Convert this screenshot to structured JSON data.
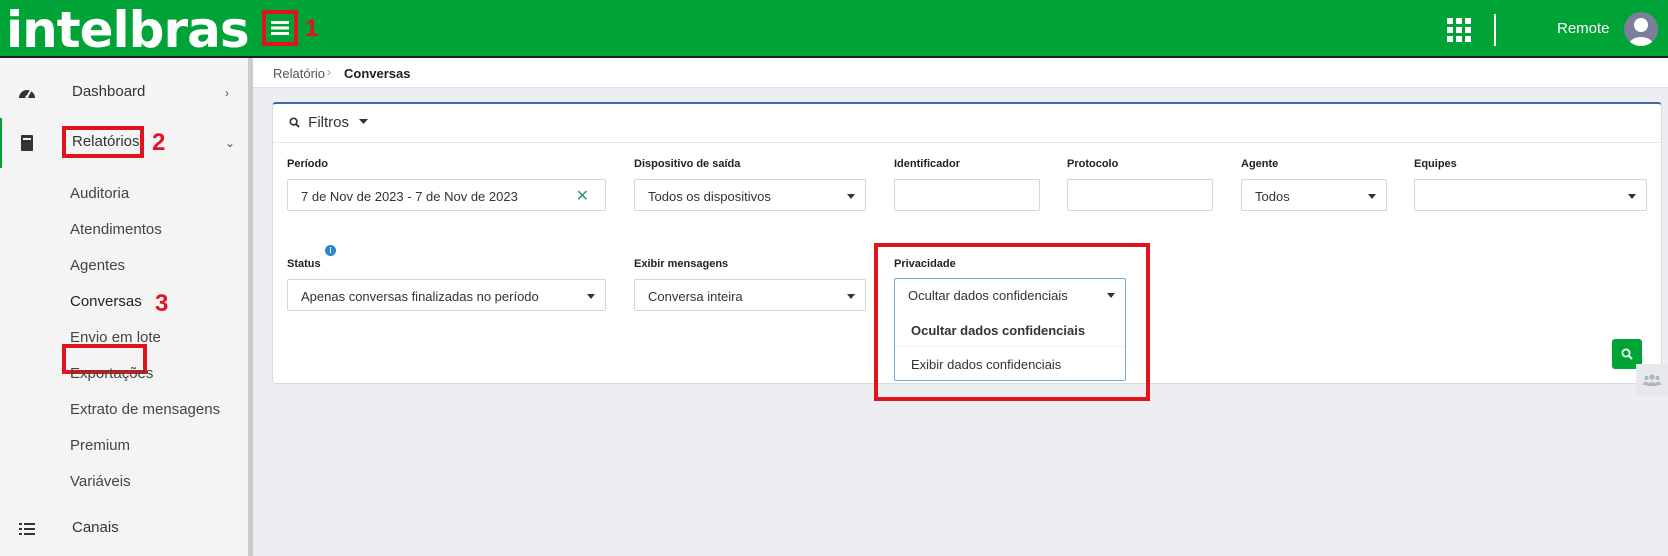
{
  "header": {
    "logo_text": "intelbras",
    "username": "Remote",
    "colors": {
      "brand": "#00a335",
      "annotation": "#e0141e"
    }
  },
  "annotations": [
    "1",
    "2",
    "3"
  ],
  "sidebar": {
    "top_items": [
      {
        "label": "Dashboard",
        "icon": "speedometer-icon",
        "chevron": "›"
      },
      {
        "label": "Relatórios",
        "icon": "book-icon",
        "chevron": "⌄"
      }
    ],
    "sub_items": [
      "Auditoria",
      "Atendimentos",
      "Agentes",
      "Conversas",
      "Envio em lote",
      "Exportações",
      "Extrato de mensagens",
      "Premium",
      "Variáveis"
    ],
    "bottom_item": {
      "label": "Canais",
      "icon": "list-icon"
    }
  },
  "breadcrumb": {
    "parent": "Relatório",
    "separator": "›",
    "current": "Conversas"
  },
  "filters": {
    "title": "Filtros",
    "periodo": {
      "label": "Período",
      "value": "7 de Nov de 2023 - 7 de Nov de 2023",
      "clear": "✕"
    },
    "dispositivo": {
      "label": "Dispositivo de saída",
      "value": "Todos os dispositivos"
    },
    "identificador": {
      "label": "Identificador",
      "value": ""
    },
    "protocolo": {
      "label": "Protocolo",
      "value": ""
    },
    "agente": {
      "label": "Agente",
      "value": "Todos"
    },
    "equipes": {
      "label": "Equipes",
      "value": ""
    },
    "status": {
      "label": "Status",
      "info": "i",
      "value": "Apenas conversas finalizadas no período"
    },
    "exibir": {
      "label": "Exibir mensagens",
      "value": "Conversa inteira"
    },
    "privacidade": {
      "label": "Privacidade",
      "value": "Ocultar dados confidenciais",
      "options": [
        "Ocultar dados confidenciais",
        "Exibir dados confidenciais"
      ]
    }
  }
}
